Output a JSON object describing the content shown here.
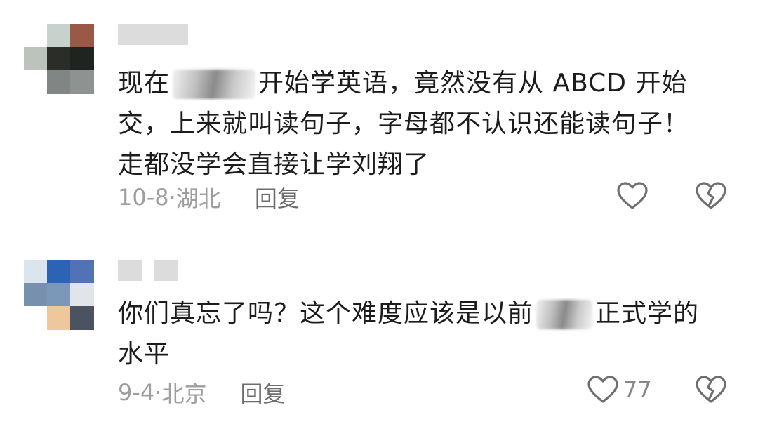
{
  "comments": [
    {
      "avatar_colors": [
        "#ffffff",
        "#c8d2cc",
        "#9a5846",
        "#bcc3bd",
        "#2a2d28",
        "#1f2420",
        "#ffffff",
        "#7f8683",
        "#8e9290"
      ],
      "text_before": "现在",
      "text_after": "开始学英语，竟然没有从 ABCD 开始交，上来就叫读句子，字母都不认识还能读句子！走都没学会直接让学刘翔了",
      "date": "10-8",
      "separator": "·",
      "location": "湖北",
      "reply_label": "回复",
      "like_count": "",
      "like_icon": "heart-outline-icon",
      "dislike_icon": "broken-heart-icon"
    },
    {
      "avatar_colors": [
        "#dbe5ee",
        "#2d63b4",
        "#5272b6",
        "#7790ad",
        "#7b98ba",
        "#e1e4e9",
        "#ffffff",
        "#efc79c",
        "#4b5360"
      ],
      "text_before": "你们真忘了吗？这个难度应该是以前",
      "text_after": "正式学的水平",
      "date": "9-4",
      "separator": "·",
      "location": "北京",
      "reply_label": "回复",
      "like_count": "77",
      "like_icon": "heart-outline-icon",
      "dislike_icon": "broken-heart-icon"
    }
  ]
}
